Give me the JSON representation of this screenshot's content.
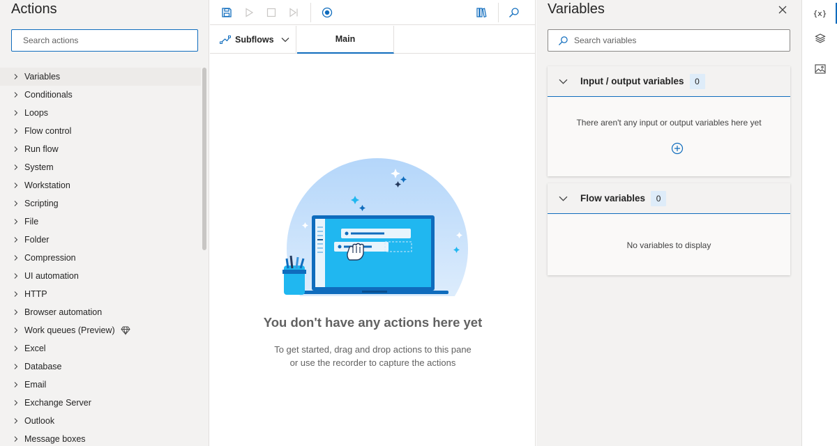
{
  "actions_pane": {
    "title": "Actions",
    "search_placeholder": "Search actions",
    "items": [
      {
        "label": "Variables"
      },
      {
        "label": "Conditionals"
      },
      {
        "label": "Loops"
      },
      {
        "label": "Flow control"
      },
      {
        "label": "Run flow"
      },
      {
        "label": "System"
      },
      {
        "label": "Workstation"
      },
      {
        "label": "Scripting"
      },
      {
        "label": "File"
      },
      {
        "label": "Folder"
      },
      {
        "label": "Compression"
      },
      {
        "label": "UI automation"
      },
      {
        "label": "HTTP"
      },
      {
        "label": "Browser automation"
      },
      {
        "label": "Work queues (Preview)",
        "icon": "premium-diamond-icon"
      },
      {
        "label": "Excel"
      },
      {
        "label": "Database"
      },
      {
        "label": "Email"
      },
      {
        "label": "Exchange Server"
      },
      {
        "label": "Outlook"
      },
      {
        "label": "Message boxes"
      }
    ]
  },
  "toolbar": {
    "icons": [
      "save-icon",
      "run-icon",
      "stop-icon",
      "run-next-action-icon",
      "recorder-icon",
      "library-icon",
      "search-icon"
    ]
  },
  "tabs": {
    "subflows_label": "Subflows",
    "main_label": "Main"
  },
  "empty_state": {
    "title": "You don't have any actions here yet",
    "description_line1": "To get started, drag and drop actions to this pane",
    "description_line2": "or use the recorder to capture the actions"
  },
  "variables_pane": {
    "title": "Variables",
    "search_placeholder": "Search variables",
    "io_section": {
      "label": "Input / output variables",
      "count": "0",
      "empty_text": "There aren't any input or output variables here yet"
    },
    "flow_section": {
      "label": "Flow variables",
      "count": "0",
      "empty_text": "No variables to display"
    }
  },
  "right_rail": {
    "variables_label": "{x}",
    "icons": [
      "variables-icon",
      "ui-elements-icon",
      "images-icon"
    ]
  },
  "colors": {
    "accent": "#0f6cbd",
    "pane_bg": "#f3f2f1",
    "count_badge_bg": "#deecf9"
  }
}
